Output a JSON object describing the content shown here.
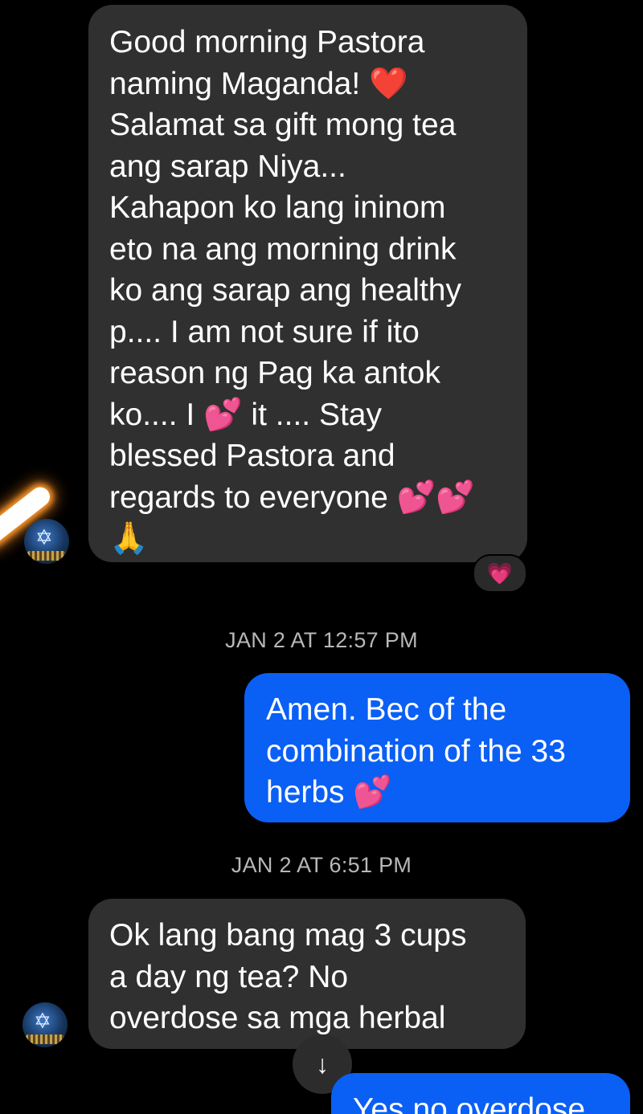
{
  "messages": [
    {
      "id": "msg1",
      "direction": "incoming",
      "lines": [
        "Good morning Pastora",
        "naming Maganda! ❤️",
        "Salamat sa gift mong tea",
        "ang sarap Niya...",
        "Kahapon ko lang ininom",
        "eto na ang morning drink",
        "ko ang sarap ang healthy",
        "p.... I am not sure if ito",
        "reason ng Pag ka antok",
        "ko.... I 💕 it .... Stay",
        "blessed Pastora and",
        "regards to everyone 💕💕",
        "🙏"
      ],
      "reaction": "💗"
    },
    {
      "id": "msg2",
      "direction": "outgoing",
      "timestamp": "JAN 2 AT 12:57 PM",
      "lines": [
        "Amen. Bec of the",
        "combination of the 33",
        "herbs 💕"
      ]
    },
    {
      "id": "msg3",
      "direction": "incoming",
      "timestamp": "JAN 2 AT 6:51 PM",
      "lines": [
        "Ok lang bang mag 3 cups",
        "a day ng tea? No",
        "overdose sa mga herbal"
      ]
    },
    {
      "id": "msg4",
      "direction": "outgoing",
      "lines": [
        "Yes no overdose"
      ]
    }
  ],
  "scroll_down_icon": "↓",
  "avatar_icon": "star-emblem-icon",
  "colors": {
    "incoming_bubble": "#303030",
    "outgoing_bubble": "#0a5ff5",
    "background": "#000000"
  }
}
